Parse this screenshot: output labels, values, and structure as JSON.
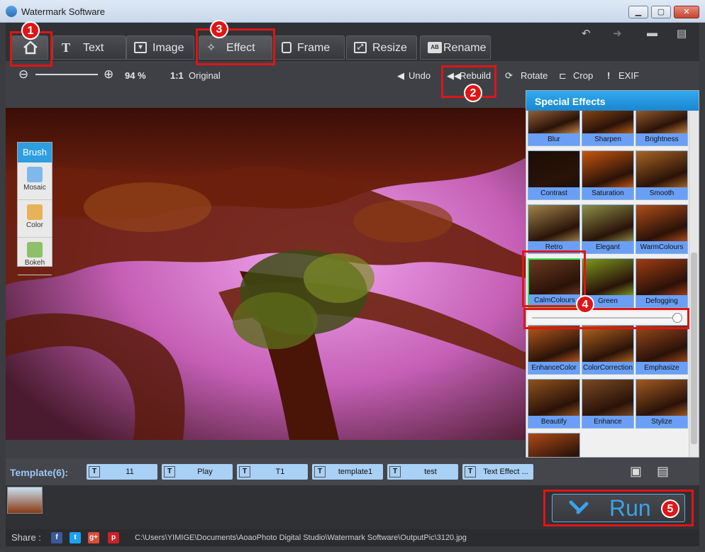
{
  "window": {
    "title": "Watermark Software",
    "minimize": "▁",
    "maximize": "▢",
    "close": "✕"
  },
  "tabs": [
    {
      "label": "",
      "icon": "home-icon"
    },
    {
      "label": "Text",
      "icon": "T"
    },
    {
      "label": "Image",
      "icon": "image-icon"
    },
    {
      "label": "Effect",
      "icon": "magic-wand-icon"
    },
    {
      "label": "Frame",
      "icon": "frame-icon"
    },
    {
      "label": "Resize",
      "icon": "resize-icon"
    },
    {
      "label": "Rename",
      "icon": "AB"
    }
  ],
  "top_icons": {
    "undo": "↶",
    "redo": "➜",
    "chat": "▬",
    "save": "▤"
  },
  "subbar": {
    "zoom_out": "⊖",
    "zoom_in": "⊕",
    "zoom_value": "94 %",
    "original_icon": "1:1",
    "original_label": "Original",
    "undo": "Undo",
    "rebuild": "Rebuild",
    "rotate": "Rotate",
    "crop": "Crop",
    "exif": "EXIF"
  },
  "brush": {
    "title": "Brush",
    "tools": [
      {
        "label": "Mosaic",
        "color": "#7fb8ea"
      },
      {
        "label": "Color",
        "color": "#e8b25a"
      },
      {
        "label": "Bokeh",
        "color": "#8ec06a"
      }
    ]
  },
  "effects_panel": {
    "title": "Special Effects",
    "items": [
      {
        "name": "Blur",
        "tint": "#c98a4e"
      },
      {
        "name": "Sharpen",
        "tint": "#b5601d"
      },
      {
        "name": "Brightness",
        "tint": "#c8823c"
      },
      {
        "name": "Contrast",
        "tint": "#1a0e05"
      },
      {
        "name": "Saturation",
        "tint": "#c8560e"
      },
      {
        "name": "Smooth",
        "tint": "#a86523"
      },
      {
        "name": "Retro",
        "tint": "#a0844a"
      },
      {
        "name": "Elegant",
        "tint": "#8c8f48"
      },
      {
        "name": "WarmColours",
        "tint": "#b14d18"
      },
      {
        "name": "CalmColours",
        "tint": "#6a3a22"
      },
      {
        "name": "Green",
        "tint": "#7d9a1f"
      },
      {
        "name": "Defogging",
        "tint": "#a23c12"
      },
      {
        "name": "EnhanceColor",
        "tint": "#b85a1c"
      },
      {
        "name": "ColorCorrection",
        "tint": "#b5661f"
      },
      {
        "name": "Emphasize",
        "tint": "#9a4a1c"
      },
      {
        "name": "Beautify",
        "tint": "#8e531d"
      },
      {
        "name": "Enhance",
        "tint": "#7a4a24"
      },
      {
        "name": "Stylize",
        "tint": "#a25a22"
      },
      {
        "name": "",
        "tint": "#b04a18"
      }
    ],
    "selected": "CalmColours",
    "strength": 1.0
  },
  "templates": {
    "label": "Template(6):",
    "items": [
      "11",
      "Play",
      "T1",
      "template1",
      "test",
      "Text Effect ..."
    ]
  },
  "run_label": "Run",
  "status": {
    "share_label": "Share :",
    "social": [
      "f",
      "t",
      "g+",
      "p"
    ],
    "path": "C:\\Users\\YIMIGE\\Documents\\AoaoPhoto Digital Studio\\Watermark Software\\OutputPic\\3120.jpg"
  },
  "callouts": [
    "1",
    "2",
    "3",
    "4",
    "5"
  ],
  "colors": {
    "accent": "#2d9ee0",
    "annotation": "#e01515",
    "effect_label": "#6a9ff5"
  }
}
